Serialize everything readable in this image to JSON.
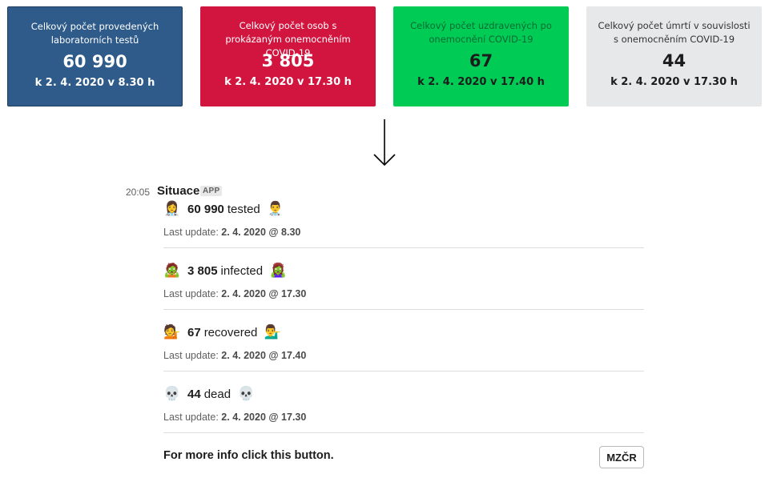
{
  "cards": [
    {
      "title": "Celkový počet provedených laboratorních testů",
      "value": "60 990",
      "date": "k 2. 4. 2020 v 8.30 h",
      "color": "#2e5b89"
    },
    {
      "title": "Celkový počet osob s prokázaným onemocněním COVID-19",
      "value": "3 805",
      "date": "k 2. 4. 2020 v 17.30 h",
      "color": "#d2153f"
    },
    {
      "title": "Celkový počet uzdravených po onemocnění COVID-19",
      "value": "67",
      "date": "k 2. 4. 2020 v 17.40 h",
      "color": "#00cc55"
    },
    {
      "title": "Celkový počet úmrtí v souvislosti s onemocněním COVID-19",
      "value": "44",
      "date": "k 2. 4. 2020 v 17.30 h",
      "color": "#e7e8e9"
    }
  ],
  "message": {
    "time": "20:05",
    "sender": "Situace",
    "badge": "APP",
    "stats": [
      {
        "emoji_left": "👩‍⚕️",
        "value": "60 990",
        "label": "tested",
        "emoji_right": "👨‍⚕️",
        "update_label": "Last update:",
        "update_value": "2. 4. 2020 @ 8.30"
      },
      {
        "emoji_left": "🧟",
        "value": "3 805",
        "label": "infected",
        "emoji_right": "🧟‍♀️",
        "update_label": "Last update:",
        "update_value": "2. 4. 2020 @ 17.30"
      },
      {
        "emoji_left": "💁",
        "value": "67",
        "label": "recovered",
        "emoji_right": "💁‍♂️",
        "update_label": "Last update:",
        "update_value": "2. 4. 2020 @ 17.40"
      },
      {
        "emoji_left": "💀",
        "value": "44",
        "label": "dead",
        "emoji_right": "💀",
        "update_label": "Last update:",
        "update_value": "2. 4. 2020 @ 17.30"
      }
    ],
    "footer_text": "For more info click this button.",
    "button_label": "MZČR"
  }
}
